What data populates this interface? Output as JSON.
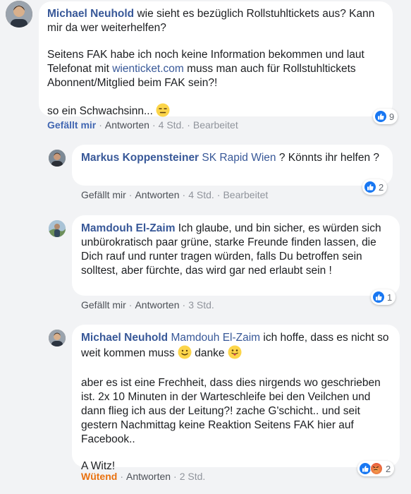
{
  "comments": [
    {
      "author": "Michael Neuhold",
      "paragraph1_text": "wie sieht es bezüglich Rollstuhltickets aus? Kann mir da wer weiterhelfen?",
      "paragraph2_before": "Seitens FAK habe ich noch keine Information bekommen und laut Telefonat mit ",
      "paragraph2_link": "wienticket.com",
      "paragraph2_after": " muss man auch für Rollstuhltickets Abonnent/Mitglied beim FAK sein?!",
      "paragraph3_text": "so ein Schwachsinn...",
      "emoji": "expressionless-face-icon",
      "reaction_label": "Gefällt mir",
      "reply_label": "Antworten",
      "time": "4 Std.",
      "edited_label": "Bearbeitet",
      "reaction_count": "9"
    },
    {
      "author": "Markus Koppensteiner",
      "mention": "SK Rapid Wien",
      "text": " ? Könnts ihr helfen ?",
      "reaction_label": "Gefällt mir",
      "reply_label": "Antworten",
      "time": "4 Std.",
      "edited_label": "Bearbeitet",
      "reaction_count": "2"
    },
    {
      "author": "Mamdouh El-Zaim",
      "text": "Ich glaube, und bin sicher, es würden sich unbürokratisch paar grüne, starke Freunde finden lassen, die Dich rauf und runter tragen würden, falls Du betroffen sein solltest, aber fürchte, das wird gar ned erlaubt sein !",
      "reaction_label": "Gefällt mir",
      "reply_label": "Antworten",
      "time": "3 Std.",
      "reaction_count": "1"
    },
    {
      "author": "Michael Neuhold",
      "mention": "Mamdouh El-Zaim",
      "paragraph1_text": " ich hoffe, dass es nicht so weit kommen muss",
      "paragraph1_tail": "danke",
      "emoji1": "slightly-smiling-face-icon",
      "emoji2": "tongue-out-face-icon",
      "paragraph2_text": "aber es ist eine Frechheit, dass dies nirgends wo geschrieben ist. 2x 10 Minuten in der Warteschleife bei den Veilchen und dann flieg ich aus der Leitung?! zache G'schicht.. und seit gestern Nachmittag keine Reaktion Seitens FAK hier auf Facebook..",
      "paragraph3_text": "A Witz!",
      "reaction_label": "Wütend",
      "reply_label": "Antworten",
      "time": "2 Std.",
      "reaction_count": "2"
    }
  ],
  "colors": {
    "link": "#385898",
    "like_blue": "#1877f2",
    "angry_orange": "#e9710f",
    "background": "#f2f3f5"
  }
}
